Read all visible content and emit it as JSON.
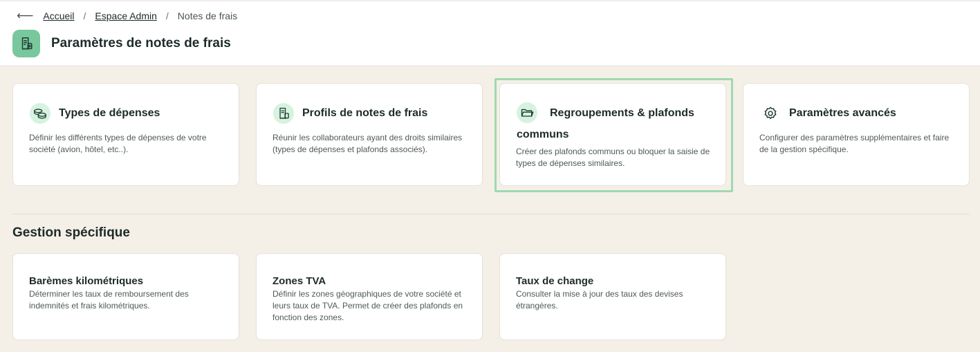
{
  "breadcrumb": {
    "back_icon": "arrow-left-icon",
    "items": [
      "Accueil",
      "Espace Admin"
    ],
    "current": "Notes de frais"
  },
  "header": {
    "title": "Paramètres de notes de frais",
    "icon": "receipt-icon",
    "icon_bg": "#79c79c"
  },
  "cards": [
    {
      "title": "Types de dépenses",
      "icon": "coins-icon",
      "desc": "Définir les différents types de dépenses de votre société (avion, hôtel, etc..)."
    },
    {
      "title": "Profils de notes de frais",
      "icon": "receipt-profile-icon",
      "desc": "Réunir les collaborateurs ayant des droits similaires (types de dépenses et plafonds associés)."
    },
    {
      "title": "Regroupements & plafonds communs",
      "icon": "folder-icon",
      "desc": "Créer des plafonds communs ou bloquer la saisie de types de dépenses similaires.",
      "highlighted": true
    },
    {
      "title": "Paramètres avancés",
      "icon": "gear-icon",
      "desc": "Configurer des paramètres supplémentaires et faire de la gestion spécifique."
    }
  ],
  "section": {
    "title": "Gestion spécifique"
  },
  "specific_cards": [
    {
      "title": "Barèmes kilométriques",
      "desc": "Déterminer les taux de remboursement des indemnités et frais kilométriques."
    },
    {
      "title": "Zones TVA",
      "desc": "Définir les zones géographiques de votre société et leurs taux de TVA. Permet de créer des plafonds en fonction des zones."
    },
    {
      "title": "Taux de change",
      "desc": "Consulter la mise à jour des taux des devises étrangères."
    }
  ],
  "colors": {
    "page_bg": "#f4f0e8",
    "accent_green": "#79c79c",
    "icon_bg_light": "#d7f2df",
    "highlight_border": "#9fd9b0"
  }
}
